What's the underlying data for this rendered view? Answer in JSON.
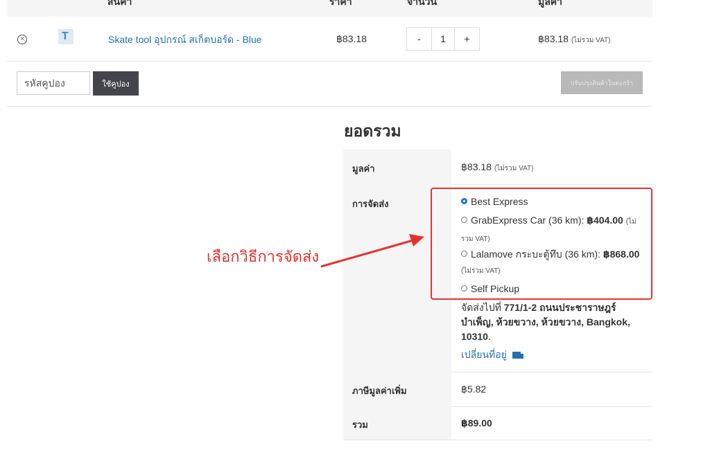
{
  "table_header": {
    "product": "สินค้า",
    "price": "ราคา",
    "quantity": "จำนวน",
    "subtotal": "มูลค่า"
  },
  "cart_item": {
    "name": "Skate tool อุปกรณ์ สเก็ตบอร์ด - Blue",
    "price": "฿83.18",
    "quantity": "1",
    "minus": "-",
    "plus": "+",
    "subtotal": "฿83.18",
    "subtotal_note": "(ไม่รวม VAT)"
  },
  "coupon": {
    "placeholder": "รหัสคูปอง",
    "apply_label": "ใช้คูปอง",
    "update_cart_label": "ปรับปรุงสินค้าในตะกร้า"
  },
  "totals": {
    "title": "ยอดรวม",
    "subtotal_label": "มูลค่า",
    "subtotal_value": "฿83.18",
    "subtotal_note": "(ไม่รวม VAT)",
    "shipping_label": "การจัดส่ง",
    "shipping_options": [
      {
        "label": "Best Express",
        "price": "",
        "note": "",
        "selected": true
      },
      {
        "label": "GrabExpress Car (36 km):",
        "price": "฿404.00",
        "note": "(ไม่รวม VAT)",
        "selected": false
      },
      {
        "label": "Lalamove กระบะตู้ทึบ (36 km):",
        "price": "฿868.00",
        "note": "(ไม่รวม VAT)",
        "selected": false
      },
      {
        "label": "Self Pickup",
        "price": "",
        "note": "",
        "selected": false
      }
    ],
    "ship_to_prefix": "จัดส่งไปที่",
    "ship_to_address": "771/1-2 ถนนประชาราษฎร์ บำเพ็ญ, ห้วยขวาง, ห้วยขวาง, Bangkok, 10310",
    "change_address": "เปลี่ยนที่อยู่",
    "vat_label": "ภาษีมูลค่าเพิ่ม",
    "vat_value": "฿5.82",
    "total_label": "รวม",
    "total_value": "฿89.00"
  },
  "annotation": {
    "text": "เลือกวิธีการจัดส่ง",
    "color": "#e8312e"
  },
  "colors": {
    "link": "#2271b1",
    "dark_button": "#43454b",
    "disabled_button": "#b9b9b9",
    "radio_selected": "#1a73e8"
  }
}
